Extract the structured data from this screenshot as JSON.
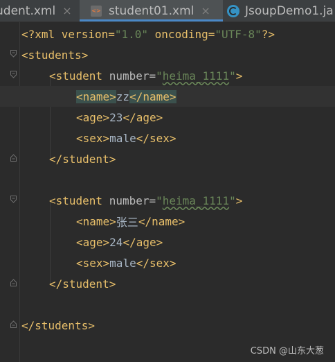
{
  "tabs": [
    {
      "label": "udent.xml",
      "icon": "none",
      "active": false,
      "close": "×"
    },
    {
      "label": "student01.xml",
      "icon": "xml-file-icon",
      "active": true,
      "close": "×"
    },
    {
      "label": "JsoupDemo1.ja",
      "icon": "java-class-icon",
      "active": false,
      "close": ""
    }
  ],
  "xml_icon_text": "<>",
  "code": {
    "l1_open": "<?xml version=",
    "l1_v1": "\"1.0\"",
    "l1_mid": " oncoding=",
    "l1_v2": "\"UTF-8\"",
    "l1_close": "?>",
    "l2": "<students>",
    "l3_open": "<student",
    "l3_attr": " number=",
    "l3_q1": "\"",
    "l3_val": "heima_1111",
    "l3_q2": "\"",
    "l3_close": ">",
    "l4_open": "<name>",
    "l4_text": "zz",
    "l4_close": "</name>",
    "l5_open": "<age>",
    "l5_text": "23",
    "l5_close": "</age>",
    "l6_open": "<sex>",
    "l6_text": "male",
    "l6_close": "</sex>",
    "l7": "</student>",
    "l9_open": "<student",
    "l9_attr": " number=",
    "l9_q1": "\"",
    "l9_val": "heima_1111",
    "l9_q2": "\"",
    "l9_close": ">",
    "l10_open": "<name>",
    "l10_text": "张三",
    "l10_close": "</name>",
    "l11_open": "<age>",
    "l11_text": "24",
    "l11_close": "</age>",
    "l12_open": "<sex>",
    "l12_text": "male",
    "l12_close": "</sex>",
    "l13": "</student>",
    "l15": "</students>"
  },
  "watermark": "CSDN @山东大葱",
  "colors": {
    "background": "#2b2b2b",
    "tag": "#e8bf6a",
    "attribute_value": "#6a8759",
    "text": "#a9b7c6",
    "tab_active_underline": "#4a88c7"
  }
}
